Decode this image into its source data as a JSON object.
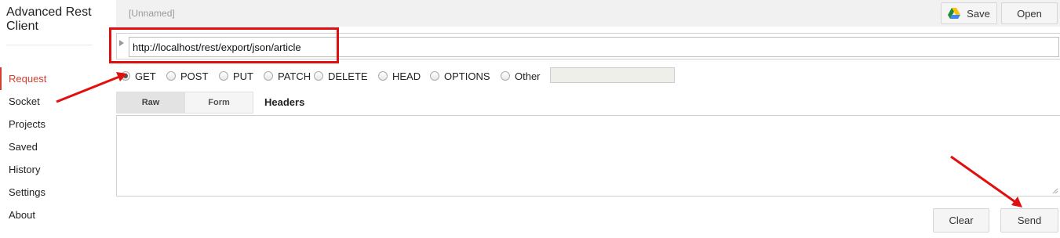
{
  "app": {
    "title": "Advanced Rest Client"
  },
  "sidebar": {
    "items": [
      {
        "label": "Request",
        "active": true
      },
      {
        "label": "Socket"
      },
      {
        "label": "Projects"
      },
      {
        "label": "Saved"
      },
      {
        "label": "History"
      },
      {
        "label": "Settings"
      },
      {
        "label": "About"
      }
    ]
  },
  "toolbar": {
    "request_name": "[Unnamed]",
    "save_label": "Save",
    "open_label": "Open",
    "save_icon": "google-drive-icon"
  },
  "request": {
    "url": "http://localhost/rest/export/json/article",
    "methods": [
      "GET",
      "POST",
      "PUT",
      "PATCH",
      "DELETE",
      "HEAD",
      "OPTIONS",
      "Other"
    ],
    "selected_method": "GET",
    "other_value": ""
  },
  "tabs": {
    "raw": "Raw",
    "form": "Form",
    "active": "Raw",
    "headers_label": "Headers"
  },
  "headers": {
    "value": ""
  },
  "actions": {
    "clear_label": "Clear",
    "send_label": "Send"
  },
  "colors": {
    "accent": "#d23f31",
    "annotation": "#e01010"
  }
}
